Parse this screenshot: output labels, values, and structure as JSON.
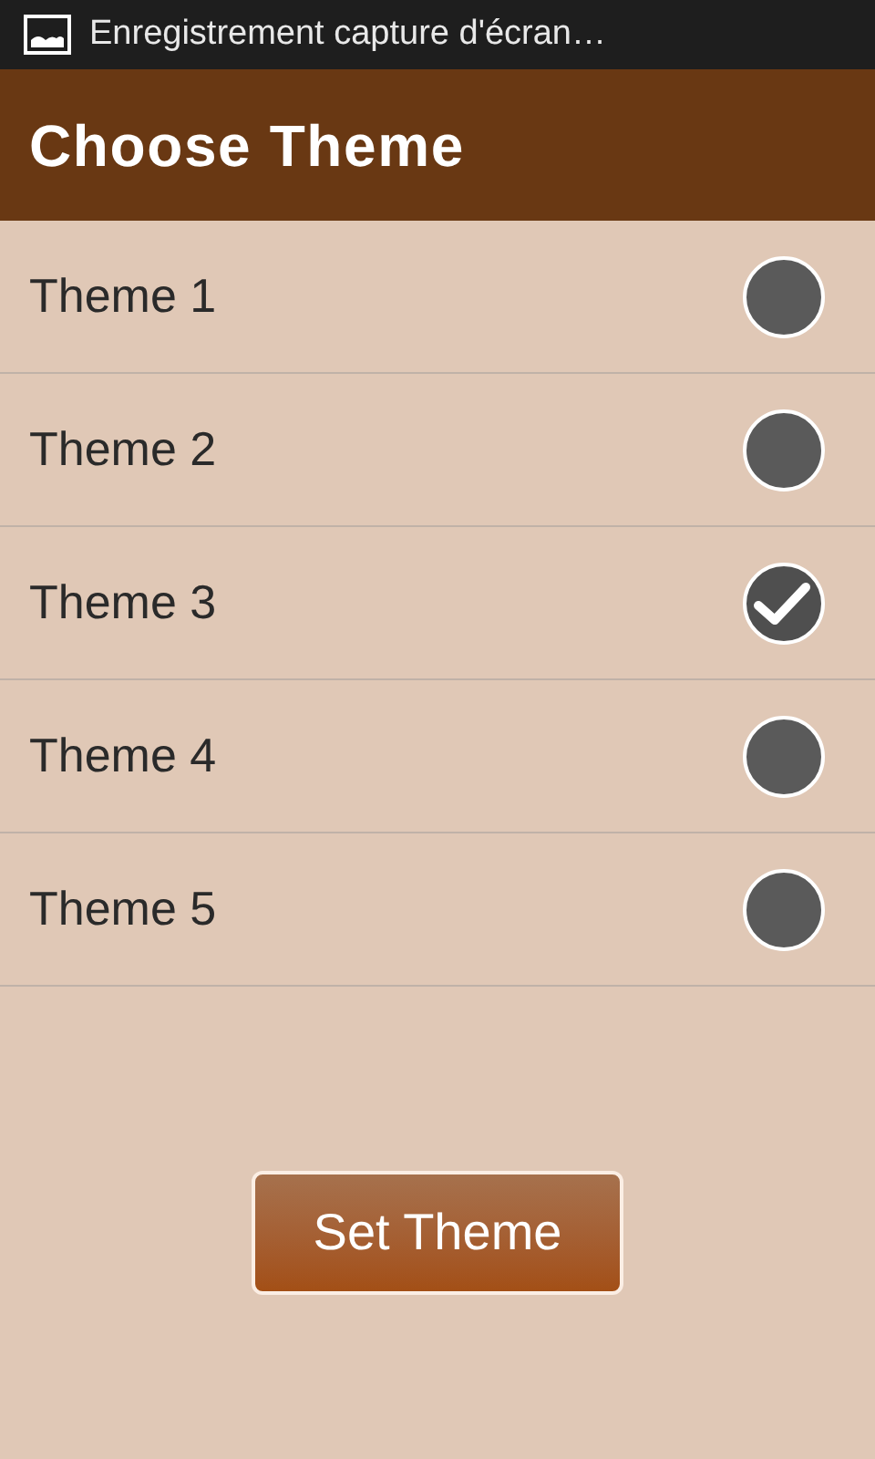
{
  "status_bar": {
    "notification": "Enregistrement capture d'écran…"
  },
  "app_bar": {
    "title": "Choose Theme"
  },
  "themes": [
    {
      "label": "Theme 1",
      "selected": false
    },
    {
      "label": "Theme 2",
      "selected": false
    },
    {
      "label": "Theme 3",
      "selected": true
    },
    {
      "label": "Theme 4",
      "selected": false
    },
    {
      "label": "Theme 5",
      "selected": false
    }
  ],
  "button": {
    "label": "Set Theme"
  }
}
